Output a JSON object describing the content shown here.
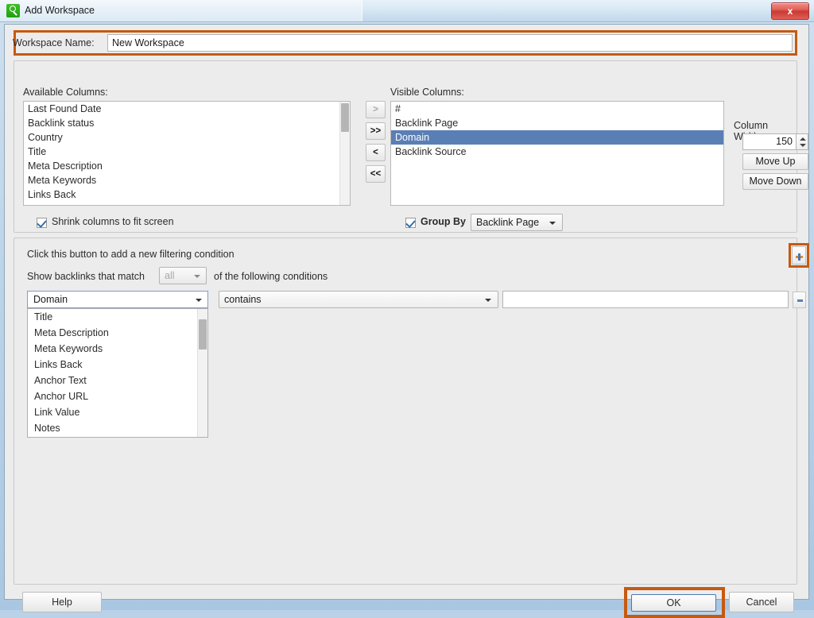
{
  "window": {
    "title": "Add Workspace",
    "icon": "magnifier-icon",
    "close_label": "x"
  },
  "name_row": {
    "label": "Workspace Name:",
    "value": "New Workspace",
    "placeholder": ""
  },
  "columns_panel": {
    "available_label": "Available Columns:",
    "visible_label": "Visible Columns:",
    "available_items": [
      "Last Found Date",
      "Backlink status",
      "Country",
      "Title",
      "Meta Description",
      "Meta Keywords",
      "Links Back"
    ],
    "visible_items": [
      {
        "label": "#",
        "selected": false
      },
      {
        "label": "Backlink Page",
        "selected": false
      },
      {
        "label": "Domain",
        "selected": true
      },
      {
        "label": "Backlink Source",
        "selected": false
      }
    ],
    "transfer_buttons": [
      {
        "label": ">",
        "disabled": true
      },
      {
        "label": ">>",
        "disabled": false
      },
      {
        "label": "<",
        "disabled": false
      },
      {
        "label": "<<",
        "disabled": false
      }
    ],
    "column_width_label": "Column Width:",
    "column_width_value": "150",
    "move_up_label": "Move Up",
    "move_down_label": "Move Down",
    "shrink_label": "Shrink columns to fit screen",
    "shrink_checked": true,
    "group_by_label": "Group By",
    "group_by_checked": true,
    "group_by_value": "Backlink Page"
  },
  "filter_panel": {
    "hint": "Click this button to add a new filtering condition",
    "match_prefix": "Show backlinks that match",
    "match_value": "all",
    "match_suffix": "of the following conditions",
    "add_button": "+",
    "remove_button": "-",
    "condition": {
      "field": "Domain",
      "operator": "contains",
      "value": "",
      "placeholder": ""
    },
    "dropdown_items": [
      "Title",
      "Meta Description",
      "Meta Keywords",
      "Links Back",
      "Anchor Text",
      "Anchor URL",
      "Link Value",
      "Notes"
    ]
  },
  "footer": {
    "help_label": "Help",
    "ok_label": "OK",
    "cancel_label": "Cancel"
  },
  "colors": {
    "highlight": "#c55a11",
    "selection": "#5a7fb5",
    "accent": "#4a79b5"
  }
}
